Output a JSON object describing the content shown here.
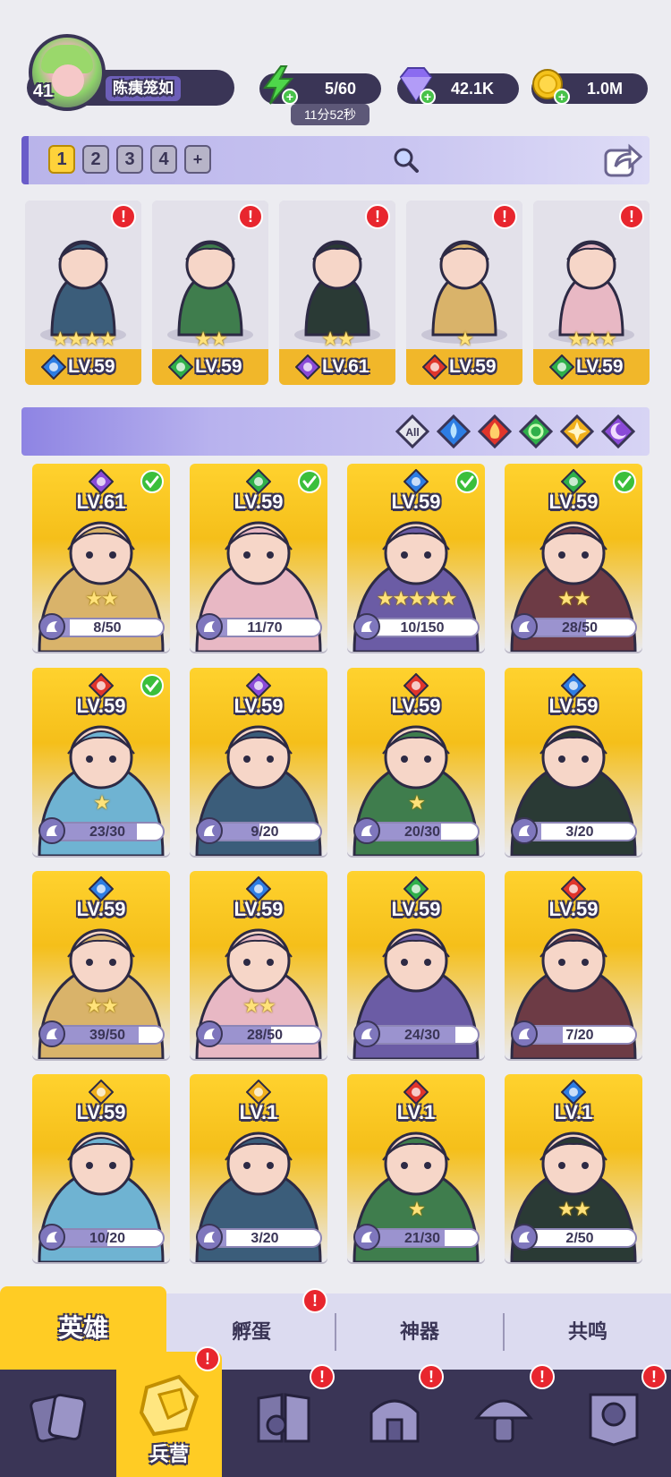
{
  "profile": {
    "level": "41",
    "name": "陈痍笼如"
  },
  "resources": {
    "energy": {
      "value": "5/60",
      "timer": "11分52秒",
      "icon": "lightning-icon",
      "color": "#4ed64a"
    },
    "gems": {
      "value": "42.1K",
      "icon": "gem-icon",
      "color": "#8b6cf0"
    },
    "gold": {
      "value": "1.0M",
      "icon": "coin-icon",
      "color": "#f4c21c"
    }
  },
  "team": {
    "tabs": [
      "1",
      "2",
      "3",
      "4",
      "+"
    ],
    "active_tab": "1",
    "heroes": [
      {
        "level": "LV.59",
        "stars": 4,
        "element": "water",
        "alert": true
      },
      {
        "level": "LV.59",
        "stars": 2,
        "element": "nature",
        "alert": true
      },
      {
        "level": "LV.61",
        "stars": 2,
        "element": "dark",
        "alert": true
      },
      {
        "level": "LV.59",
        "stars": 1,
        "element": "fire",
        "alert": true
      },
      {
        "level": "LV.59",
        "stars": 3,
        "element": "nature",
        "alert": true
      }
    ]
  },
  "filter": {
    "all_label": "All",
    "elements": [
      "water",
      "fire",
      "nature",
      "light",
      "dark"
    ]
  },
  "roster": [
    {
      "level": "LV.61",
      "element": "dark",
      "check": true,
      "stars": 2,
      "shards": "8/50",
      "fill": 0.16
    },
    {
      "level": "LV.59",
      "element": "nature",
      "check": true,
      "stars": 0,
      "shards": "11/70",
      "fill": 0.157
    },
    {
      "level": "LV.59",
      "element": "water",
      "check": true,
      "stars": 5,
      "shards": "10/150",
      "fill": 0.067
    },
    {
      "level": "LV.59",
      "element": "nature",
      "check": true,
      "stars": 2,
      "shards": "28/50",
      "fill": 0.56
    },
    {
      "level": "LV.59",
      "element": "fire",
      "check": true,
      "stars": 1,
      "shards": "23/30",
      "fill": 0.767
    },
    {
      "level": "LV.59",
      "element": "dark",
      "check": false,
      "stars": 0,
      "shards": "9/20",
      "fill": 0.45
    },
    {
      "level": "LV.59",
      "element": "fire",
      "check": false,
      "stars": 1,
      "shards": "20/30",
      "fill": 0.667
    },
    {
      "level": "LV.59",
      "element": "water",
      "check": false,
      "stars": 0,
      "shards": "3/20",
      "fill": 0.15
    },
    {
      "level": "LV.59",
      "element": "water",
      "check": false,
      "stars": 2,
      "shards": "39/50",
      "fill": 0.78
    },
    {
      "level": "LV.59",
      "element": "water",
      "check": false,
      "stars": 2,
      "shards": "28/50",
      "fill": 0.56
    },
    {
      "level": "LV.59",
      "element": "nature",
      "check": false,
      "stars": 0,
      "shards": "24/30",
      "fill": 0.8
    },
    {
      "level": "LV.59",
      "element": "fire",
      "check": false,
      "stars": 0,
      "shards": "7/20",
      "fill": 0.35
    },
    {
      "level": "LV.59",
      "element": "light",
      "check": false,
      "stars": 0,
      "shards": "10/20",
      "fill": 0.5
    },
    {
      "level": "LV.1",
      "element": "light",
      "check": false,
      "stars": 0,
      "shards": "3/20",
      "fill": 0.15
    },
    {
      "level": "LV.1",
      "element": "fire",
      "check": false,
      "stars": 1,
      "shards": "21/30",
      "fill": 0.7
    },
    {
      "level": "LV.1",
      "element": "water",
      "check": false,
      "stars": 2,
      "shards": "2/50",
      "fill": 0.04
    }
  ],
  "tabs": {
    "heroes": "英雄",
    "hatch": "孵蛋",
    "artifact": "神器",
    "resonance": "共鸣"
  },
  "nav": {
    "barracks": "兵营",
    "items": [
      "cards-icon",
      "barracks-icon",
      "book-icon",
      "castle-icon",
      "mushroom-icon",
      "banner-icon"
    ]
  },
  "colors": {
    "water": "#2d7de3",
    "fire": "#e0352b",
    "nature": "#2fb04a",
    "light": "#f0b01c",
    "dark": "#8a4ad8",
    "accent": "#ffcc24",
    "panel": "#3a3556"
  }
}
